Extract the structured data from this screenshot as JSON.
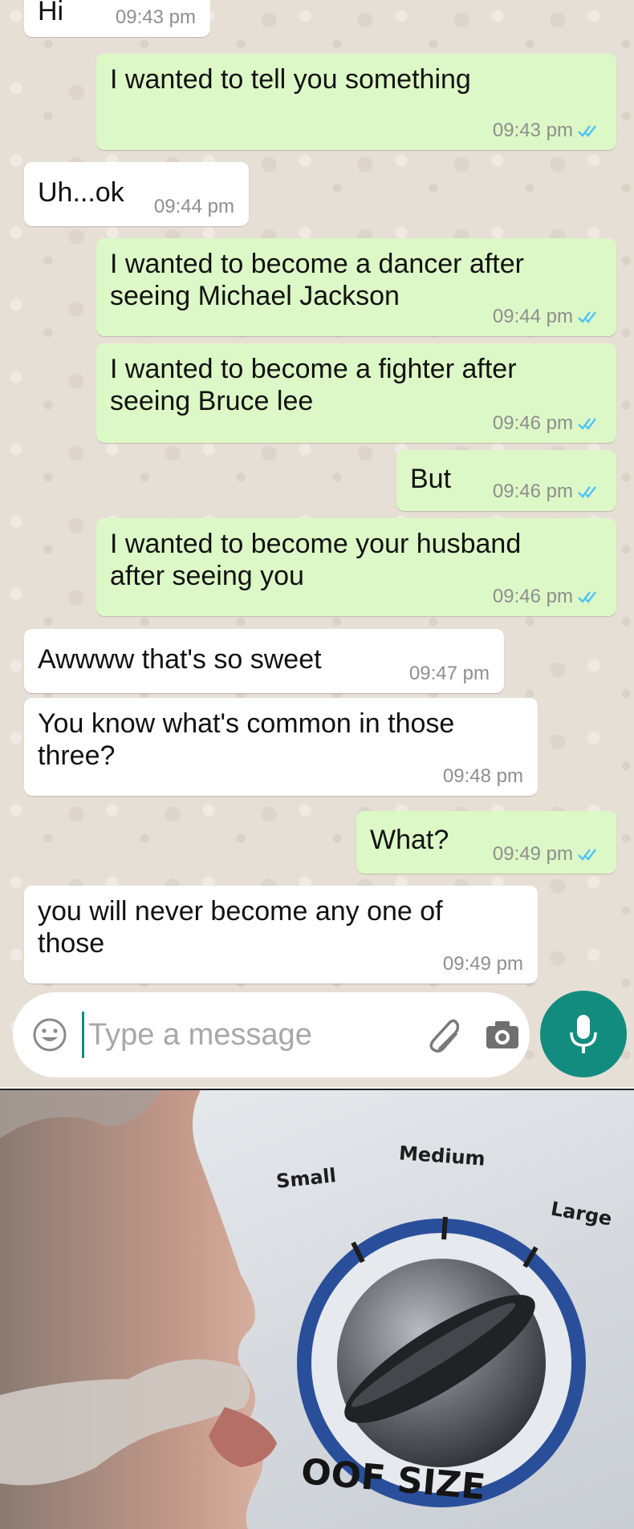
{
  "messages": [
    {
      "text": "Hi",
      "time": "09:43 pm",
      "direction": "incoming"
    },
    {
      "text": "I wanted to tell you something",
      "time": "09:43 pm",
      "direction": "outgoing"
    },
    {
      "text": "Uh...ok",
      "time": "09:44 pm",
      "direction": "incoming"
    },
    {
      "text": "I wanted to become a dancer after\nseeing Michael Jackson",
      "time": "09:44 pm",
      "direction": "outgoing"
    },
    {
      "text": "I wanted to become a fighter after\nseeing Bruce lee",
      "time": "09:46 pm",
      "direction": "outgoing"
    },
    {
      "text": "But",
      "time": "09:46 pm",
      "direction": "outgoing"
    },
    {
      "text": "I wanted to become your husband\nafter seeing you",
      "time": "09:46 pm",
      "direction": "outgoing"
    },
    {
      "text": "Awwww that's so sweet",
      "time": "09:47 pm",
      "direction": "incoming"
    },
    {
      "text": "You know what's common in those\nthree?",
      "time": "09:48 pm",
      "direction": "incoming"
    },
    {
      "text": "What?",
      "time": "09:49 pm",
      "direction": "outgoing"
    },
    {
      "text": "you will never become any one of\nthose",
      "time": "09:49 pm",
      "direction": "incoming"
    }
  ],
  "composer": {
    "placeholder": "Type a message",
    "icons": [
      "emoji-icon",
      "paperclip-icon",
      "camera-icon",
      "microphone-icon"
    ]
  },
  "colors": {
    "incoming_bubble": "#ffffff",
    "outgoing_bubble": "#dcf8c6",
    "chat_background": "#e6dfd6",
    "read_ticks": "#4fc3f7",
    "accent": "#128c7e"
  },
  "meme": {
    "labels": {
      "small": "Small",
      "medium": "Medium",
      "large": "Large"
    },
    "caption": "OOF SIZE",
    "dial_setting": "large"
  }
}
